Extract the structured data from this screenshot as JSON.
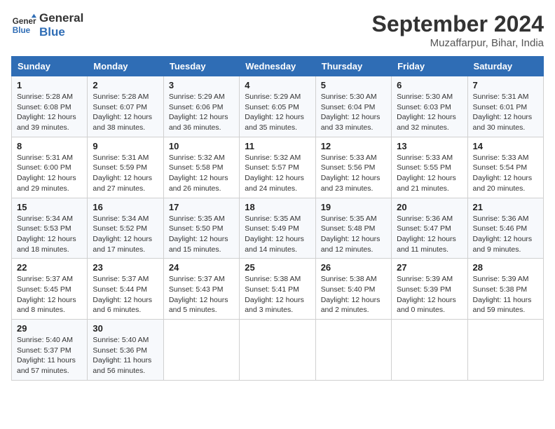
{
  "header": {
    "logo_text_general": "General",
    "logo_text_blue": "Blue",
    "month_title": "September 2024",
    "subtitle": "Muzaffarpur, Bihar, India"
  },
  "columns": [
    "Sunday",
    "Monday",
    "Tuesday",
    "Wednesday",
    "Thursday",
    "Friday",
    "Saturday"
  ],
  "weeks": [
    [
      {
        "day": "1",
        "sunrise": "Sunrise: 5:28 AM",
        "sunset": "Sunset: 6:08 PM",
        "daylight": "Daylight: 12 hours and 39 minutes."
      },
      {
        "day": "2",
        "sunrise": "Sunrise: 5:28 AM",
        "sunset": "Sunset: 6:07 PM",
        "daylight": "Daylight: 12 hours and 38 minutes."
      },
      {
        "day": "3",
        "sunrise": "Sunrise: 5:29 AM",
        "sunset": "Sunset: 6:06 PM",
        "daylight": "Daylight: 12 hours and 36 minutes."
      },
      {
        "day": "4",
        "sunrise": "Sunrise: 5:29 AM",
        "sunset": "Sunset: 6:05 PM",
        "daylight": "Daylight: 12 hours and 35 minutes."
      },
      {
        "day": "5",
        "sunrise": "Sunrise: 5:30 AM",
        "sunset": "Sunset: 6:04 PM",
        "daylight": "Daylight: 12 hours and 33 minutes."
      },
      {
        "day": "6",
        "sunrise": "Sunrise: 5:30 AM",
        "sunset": "Sunset: 6:03 PM",
        "daylight": "Daylight: 12 hours and 32 minutes."
      },
      {
        "day": "7",
        "sunrise": "Sunrise: 5:31 AM",
        "sunset": "Sunset: 6:01 PM",
        "daylight": "Daylight: 12 hours and 30 minutes."
      }
    ],
    [
      {
        "day": "8",
        "sunrise": "Sunrise: 5:31 AM",
        "sunset": "Sunset: 6:00 PM",
        "daylight": "Daylight: 12 hours and 29 minutes."
      },
      {
        "day": "9",
        "sunrise": "Sunrise: 5:31 AM",
        "sunset": "Sunset: 5:59 PM",
        "daylight": "Daylight: 12 hours and 27 minutes."
      },
      {
        "day": "10",
        "sunrise": "Sunrise: 5:32 AM",
        "sunset": "Sunset: 5:58 PM",
        "daylight": "Daylight: 12 hours and 26 minutes."
      },
      {
        "day": "11",
        "sunrise": "Sunrise: 5:32 AM",
        "sunset": "Sunset: 5:57 PM",
        "daylight": "Daylight: 12 hours and 24 minutes."
      },
      {
        "day": "12",
        "sunrise": "Sunrise: 5:33 AM",
        "sunset": "Sunset: 5:56 PM",
        "daylight": "Daylight: 12 hours and 23 minutes."
      },
      {
        "day": "13",
        "sunrise": "Sunrise: 5:33 AM",
        "sunset": "Sunset: 5:55 PM",
        "daylight": "Daylight: 12 hours and 21 minutes."
      },
      {
        "day": "14",
        "sunrise": "Sunrise: 5:33 AM",
        "sunset": "Sunset: 5:54 PM",
        "daylight": "Daylight: 12 hours and 20 minutes."
      }
    ],
    [
      {
        "day": "15",
        "sunrise": "Sunrise: 5:34 AM",
        "sunset": "Sunset: 5:53 PM",
        "daylight": "Daylight: 12 hours and 18 minutes."
      },
      {
        "day": "16",
        "sunrise": "Sunrise: 5:34 AM",
        "sunset": "Sunset: 5:52 PM",
        "daylight": "Daylight: 12 hours and 17 minutes."
      },
      {
        "day": "17",
        "sunrise": "Sunrise: 5:35 AM",
        "sunset": "Sunset: 5:50 PM",
        "daylight": "Daylight: 12 hours and 15 minutes."
      },
      {
        "day": "18",
        "sunrise": "Sunrise: 5:35 AM",
        "sunset": "Sunset: 5:49 PM",
        "daylight": "Daylight: 12 hours and 14 minutes."
      },
      {
        "day": "19",
        "sunrise": "Sunrise: 5:35 AM",
        "sunset": "Sunset: 5:48 PM",
        "daylight": "Daylight: 12 hours and 12 minutes."
      },
      {
        "day": "20",
        "sunrise": "Sunrise: 5:36 AM",
        "sunset": "Sunset: 5:47 PM",
        "daylight": "Daylight: 12 hours and 11 minutes."
      },
      {
        "day": "21",
        "sunrise": "Sunrise: 5:36 AM",
        "sunset": "Sunset: 5:46 PM",
        "daylight": "Daylight: 12 hours and 9 minutes."
      }
    ],
    [
      {
        "day": "22",
        "sunrise": "Sunrise: 5:37 AM",
        "sunset": "Sunset: 5:45 PM",
        "daylight": "Daylight: 12 hours and 8 minutes."
      },
      {
        "day": "23",
        "sunrise": "Sunrise: 5:37 AM",
        "sunset": "Sunset: 5:44 PM",
        "daylight": "Daylight: 12 hours and 6 minutes."
      },
      {
        "day": "24",
        "sunrise": "Sunrise: 5:37 AM",
        "sunset": "Sunset: 5:43 PM",
        "daylight": "Daylight: 12 hours and 5 minutes."
      },
      {
        "day": "25",
        "sunrise": "Sunrise: 5:38 AM",
        "sunset": "Sunset: 5:41 PM",
        "daylight": "Daylight: 12 hours and 3 minutes."
      },
      {
        "day": "26",
        "sunrise": "Sunrise: 5:38 AM",
        "sunset": "Sunset: 5:40 PM",
        "daylight": "Daylight: 12 hours and 2 minutes."
      },
      {
        "day": "27",
        "sunrise": "Sunrise: 5:39 AM",
        "sunset": "Sunset: 5:39 PM",
        "daylight": "Daylight: 12 hours and 0 minutes."
      },
      {
        "day": "28",
        "sunrise": "Sunrise: 5:39 AM",
        "sunset": "Sunset: 5:38 PM",
        "daylight": "Daylight: 11 hours and 59 minutes."
      }
    ],
    [
      {
        "day": "29",
        "sunrise": "Sunrise: 5:40 AM",
        "sunset": "Sunset: 5:37 PM",
        "daylight": "Daylight: 11 hours and 57 minutes."
      },
      {
        "day": "30",
        "sunrise": "Sunrise: 5:40 AM",
        "sunset": "Sunset: 5:36 PM",
        "daylight": "Daylight: 11 hours and 56 minutes."
      },
      null,
      null,
      null,
      null,
      null
    ]
  ]
}
